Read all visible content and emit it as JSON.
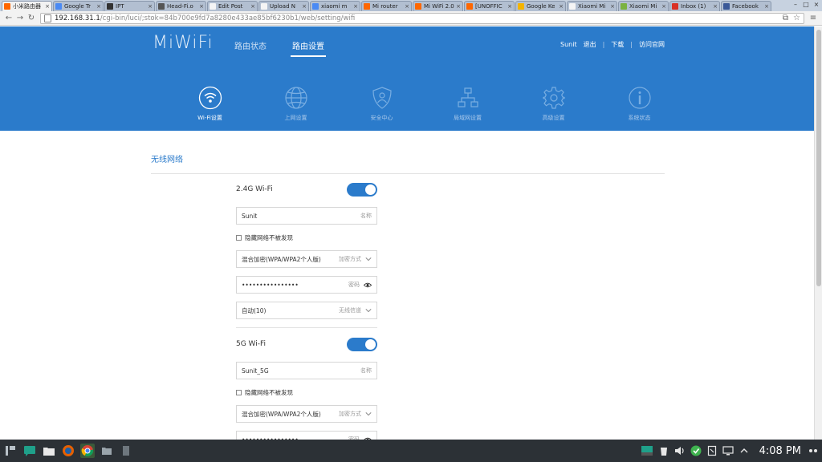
{
  "browser": {
    "tabs": [
      {
        "title": "小米路由器",
        "active": true,
        "favicon_color": "#ff6700"
      },
      {
        "title": "Google Tr",
        "favicon_color": "#4a8af4"
      },
      {
        "title": "IPT",
        "favicon_color": "#333333"
      },
      {
        "title": "Head-Fi.o",
        "favicon_color": "#555555"
      },
      {
        "title": "Edit Post",
        "favicon_color": "#f5f5f5"
      },
      {
        "title": "Upload N",
        "favicon_color": "#f5f5f5"
      },
      {
        "title": "xiaomi m",
        "favicon_color": "#4a8af4"
      },
      {
        "title": "Mi router",
        "favicon_color": "#ff6700"
      },
      {
        "title": "Mi WiFi 2.0",
        "favicon_color": "#ff6700"
      },
      {
        "title": "[UNOFFIC",
        "favicon_color": "#ff6700"
      },
      {
        "title": "Google Ke",
        "favicon_color": "#f4b400"
      },
      {
        "title": "Xiaomi Mi",
        "favicon_color": "#f5f5f5"
      },
      {
        "title": "Xiaomi Mi",
        "favicon_color": "#7bb241"
      },
      {
        "title": "Inbox (1)",
        "favicon_color": "#d93025"
      },
      {
        "title": "Facebook",
        "favicon_color": "#3b5998"
      }
    ],
    "tab_close": "×",
    "url_host": "192.168.31.1",
    "url_path": "/cgi-bin/luci/;stok=84b700e9fd7a8280e433ae85bf6230b1/web/setting/wifi"
  },
  "header": {
    "logo": "MiWiFi",
    "nav": [
      {
        "label": "路由状态",
        "active": false
      },
      {
        "label": "路由设置",
        "active": true
      }
    ],
    "user": {
      "name": "Sunit",
      "logout": "退出",
      "download": "下载",
      "official": "访问官网"
    }
  },
  "sections": [
    {
      "label": "Wi-Fi设置",
      "icon": "wifi-icon",
      "active": true
    },
    {
      "label": "上网设置",
      "icon": "globe-icon",
      "active": false
    },
    {
      "label": "安全中心",
      "icon": "shield-icon",
      "active": false
    },
    {
      "label": "局域网设置",
      "icon": "lan-icon",
      "active": false
    },
    {
      "label": "高级设置",
      "icon": "gear-icon",
      "active": false
    },
    {
      "label": "系统状态",
      "icon": "info-icon",
      "active": false
    }
  ],
  "main": {
    "title": "无线网络",
    "bands": [
      {
        "label": "2.4G Wi-Fi",
        "enabled": true,
        "ssid": "Sunit",
        "ssid_hint": "名称",
        "hide_label": "隐藏网络不被发现",
        "encryption": "混合加密(WPA/WPA2个人版)",
        "encryption_hint": "加密方式",
        "password": "••••••••••••••••",
        "password_hint": "密码",
        "channel": "自动(10)",
        "channel_hint": "无线信道"
      },
      {
        "label": "5G Wi-Fi",
        "enabled": true,
        "ssid": "Sunit_5G",
        "ssid_hint": "名称",
        "hide_label": "隐藏网络不被发现",
        "encryption": "混合加密(WPA/WPA2个人版)",
        "encryption_hint": "加密方式",
        "password": "••••••••••••••••",
        "password_hint": "密码"
      }
    ]
  },
  "taskbar": {
    "clock": "4:08 PM"
  },
  "colors": {
    "brand_blue": "#2b7bcb",
    "taskbar": "#2c3136"
  }
}
